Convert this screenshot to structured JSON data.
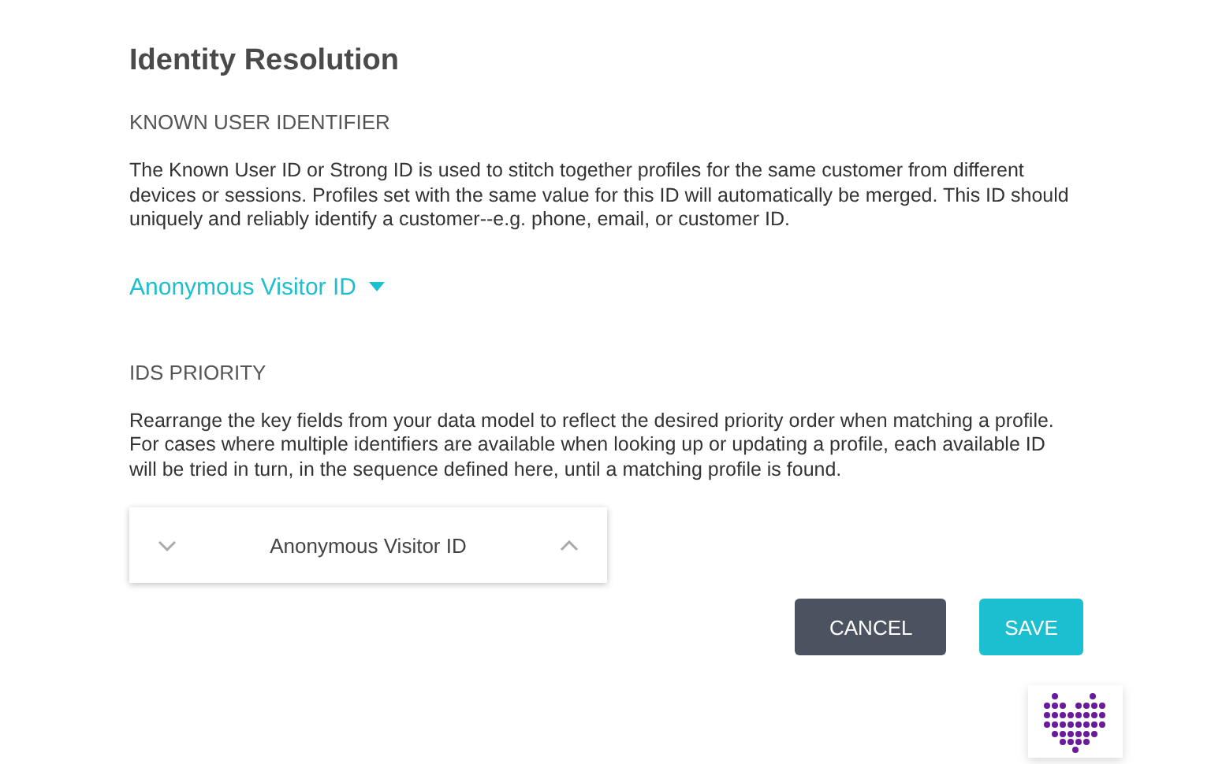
{
  "title": "Identity Resolution",
  "sections": [
    {
      "heading": "KNOWN USER IDENTIFIER",
      "text": "The Known User ID or Strong ID is used to stitch together profiles for the same customer from different devices or sessions. Profiles set with the same value for this ID will automatically be merged. This ID should uniquely and reliably identify a customer--e.g. phone, email, or customer ID.",
      "kind": "dropdown",
      "value": "Anonymous Visitor ID"
    },
    {
      "heading": "IDS PRIORITY",
      "text": "Rearrange the key fields from your data model to reflect the desired priority order when matching a profile. For cases where multiple identifiers are available when looking up or updating a profile, each available ID will be tried in turn, in the sequence defined here, until a matching profile is found.",
      "kind": "priority-list",
      "items": [
        "Anonymous Visitor ID"
      ]
    }
  ],
  "buttons": [
    {
      "label": "CANCEL",
      "kind": "secondary"
    },
    {
      "label": "SAVE",
      "kind": "primary"
    }
  ]
}
